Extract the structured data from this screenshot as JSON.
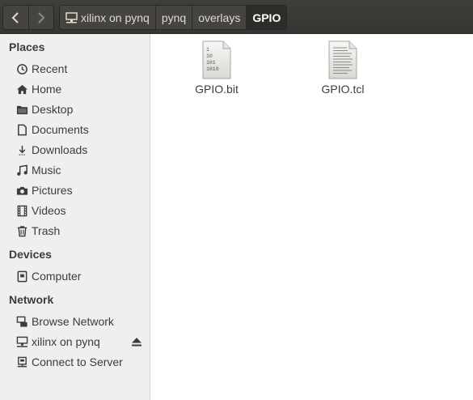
{
  "toolbar": {
    "back_icon": "chevron-left-icon",
    "forward_icon": "chevron-right-icon"
  },
  "breadcrumb": [
    {
      "label": "xilinx on pynq",
      "icon": "network-drive-icon"
    },
    {
      "label": "pynq"
    },
    {
      "label": "overlays"
    },
    {
      "label": "GPIO",
      "active": true
    }
  ],
  "sidebar": {
    "places_heading": "Places",
    "places": [
      {
        "label": "Recent",
        "icon": "clock-icon"
      },
      {
        "label": "Home",
        "icon": "home-icon"
      },
      {
        "label": "Desktop",
        "icon": "folder-icon"
      },
      {
        "label": "Documents",
        "icon": "document-icon"
      },
      {
        "label": "Downloads",
        "icon": "download-icon"
      },
      {
        "label": "Music",
        "icon": "music-icon"
      },
      {
        "label": "Pictures",
        "icon": "camera-icon"
      },
      {
        "label": "Videos",
        "icon": "film-icon"
      },
      {
        "label": "Trash",
        "icon": "trash-icon"
      }
    ],
    "devices_heading": "Devices",
    "devices": [
      {
        "label": "Computer",
        "icon": "computer-icon"
      }
    ],
    "network_heading": "Network",
    "network": [
      {
        "label": "Browse Network",
        "icon": "network-icon"
      },
      {
        "label": "xilinx on pynq",
        "icon": "network-drive-icon",
        "eject": true
      },
      {
        "label": "Connect to Server",
        "icon": "server-icon"
      }
    ]
  },
  "files": [
    {
      "name": "GPIO.bit",
      "icon": "binary-file-icon",
      "binary_lines": [
        "1",
        "10",
        "101",
        "1010"
      ]
    },
    {
      "name": "GPIO.tcl",
      "icon": "text-file-icon"
    }
  ],
  "colors": {
    "topbar": "#3f3e3a",
    "sidebar": "#f0efed",
    "text": "#3c3c3c",
    "active_crumb": "#2d2c29"
  }
}
